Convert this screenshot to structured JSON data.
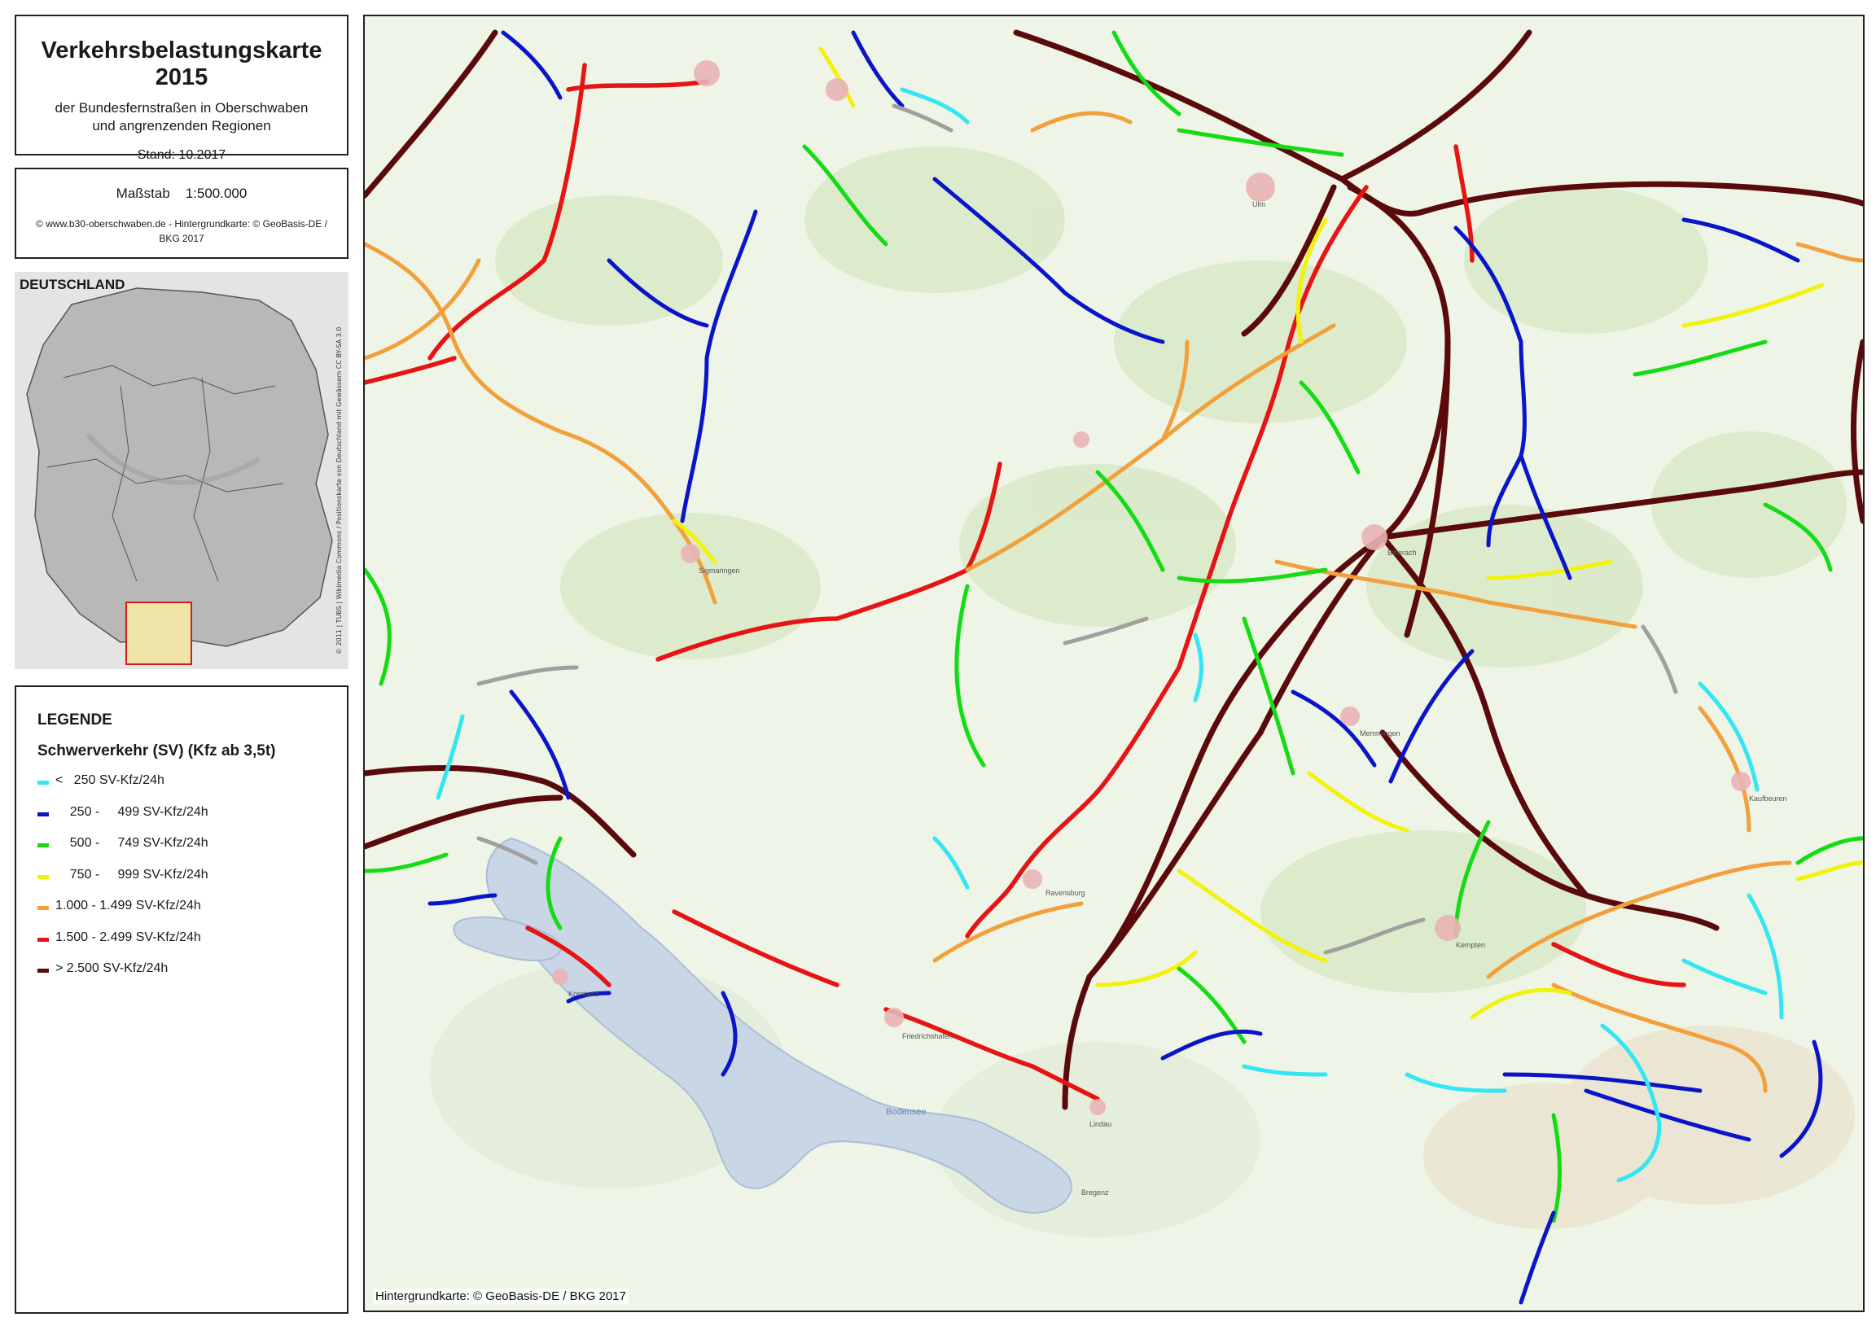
{
  "title": {
    "main": "Verkehrsbelastungskarte 2015",
    "sub1": "der Bundesfernstraßen in Oberschwaben",
    "sub2": "und angrenzenden Regionen",
    "stand": "Stand: 10.2017"
  },
  "scale": {
    "label": "Maßstab    1:500.000",
    "credit": "© www.b30-oberschwaben.de - Hintergrundkarte: © GeoBasis-DE / BKG 2017"
  },
  "overview": {
    "label": "DEUTSCHLAND",
    "credit": "© 2011 | TUBS | Wikimedia Commons / Positionskarte von Deutschland mit Gewässern CC BY-SA 3.0"
  },
  "legend": {
    "heading": "LEGENDE",
    "subheading": "Schwerverkehr (SV) (Kfz ab 3,5t)",
    "items": [
      {
        "label": "<   250 SV-Kfz/24h",
        "color": "#33e6f2"
      },
      {
        "label": "    250 -     499 SV-Kfz/24h",
        "color": "#0a14c8"
      },
      {
        "label": "    500 -     749 SV-Kfz/24h",
        "color": "#14dc14"
      },
      {
        "label": "    750 -     999 SV-Kfz/24h",
        "color": "#f2f20a"
      },
      {
        "label": "1.000 - 1.499 SV-Kfz/24h",
        "color": "#f2a03c"
      },
      {
        "label": "1.500 - 2.499 SV-Kfz/24h",
        "color": "#e61414"
      },
      {
        "label": "> 2.500 SV-Kfz/24h",
        "color": "#5a0a0a"
      }
    ]
  },
  "map": {
    "credit": "Hintergrundkarte: © GeoBasis-DE / BKG 2017",
    "lake_color": "#c8d6e6",
    "places": [
      "Ulm",
      "Biberach",
      "Ravensburg",
      "Friedrichshafen",
      "Lindau",
      "Memmingen",
      "Kempten",
      "Konstanz",
      "Bregenz",
      "Sigmaringen",
      "Kaufbeuren",
      "Bodensee"
    ]
  }
}
